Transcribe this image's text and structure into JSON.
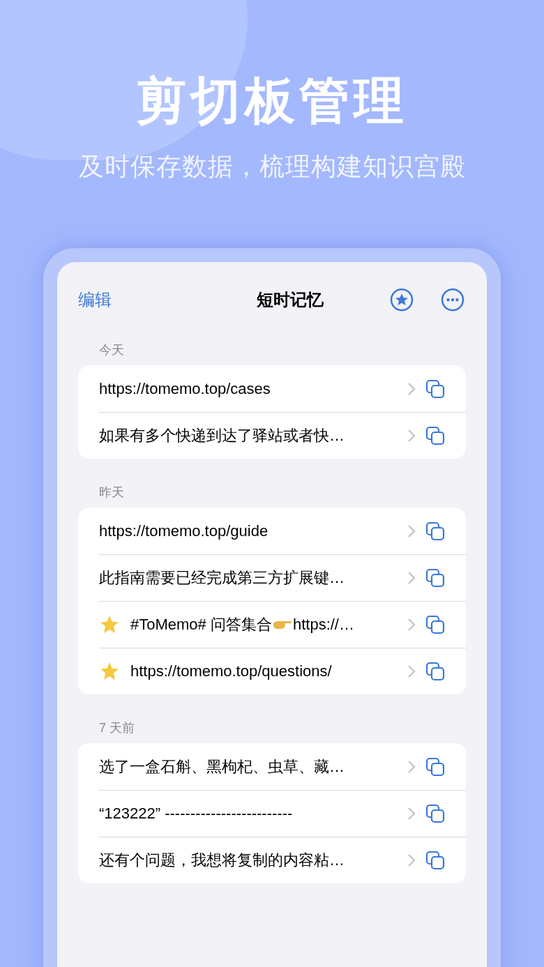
{
  "headline": "剪切板管理",
  "subheadline": "及时保存数据，梳理构建知识宫殿",
  "nav": {
    "edit": "编辑",
    "title": "短时记忆"
  },
  "sections": [
    {
      "header": "今天",
      "items": [
        {
          "text": "https://tomemo.top/cases",
          "starred": false
        },
        {
          "text": "如果有多个快递到达了驿站或者快…",
          "starred": false
        }
      ]
    },
    {
      "header": "昨天",
      "items": [
        {
          "text": "https://tomemo.top/guide",
          "starred": false
        },
        {
          "text": "此指南需要已经完成第三方扩展键…",
          "starred": false
        },
        {
          "text": "#ToMemo# 问答集合 ",
          "pointer": true,
          "text_after": "https://…",
          "starred": true
        },
        {
          "text": "https://tomemo.top/questions/",
          "starred": true
        }
      ]
    },
    {
      "header": "7 天前",
      "items": [
        {
          "text": "选了一盒石斛、黑枸杞、虫草、藏…",
          "starred": false
        },
        {
          "text": "“123222” -------------------------",
          "starred": false
        },
        {
          "text": "还有个问题，我想将复制的内容粘…",
          "starred": false
        }
      ]
    }
  ]
}
